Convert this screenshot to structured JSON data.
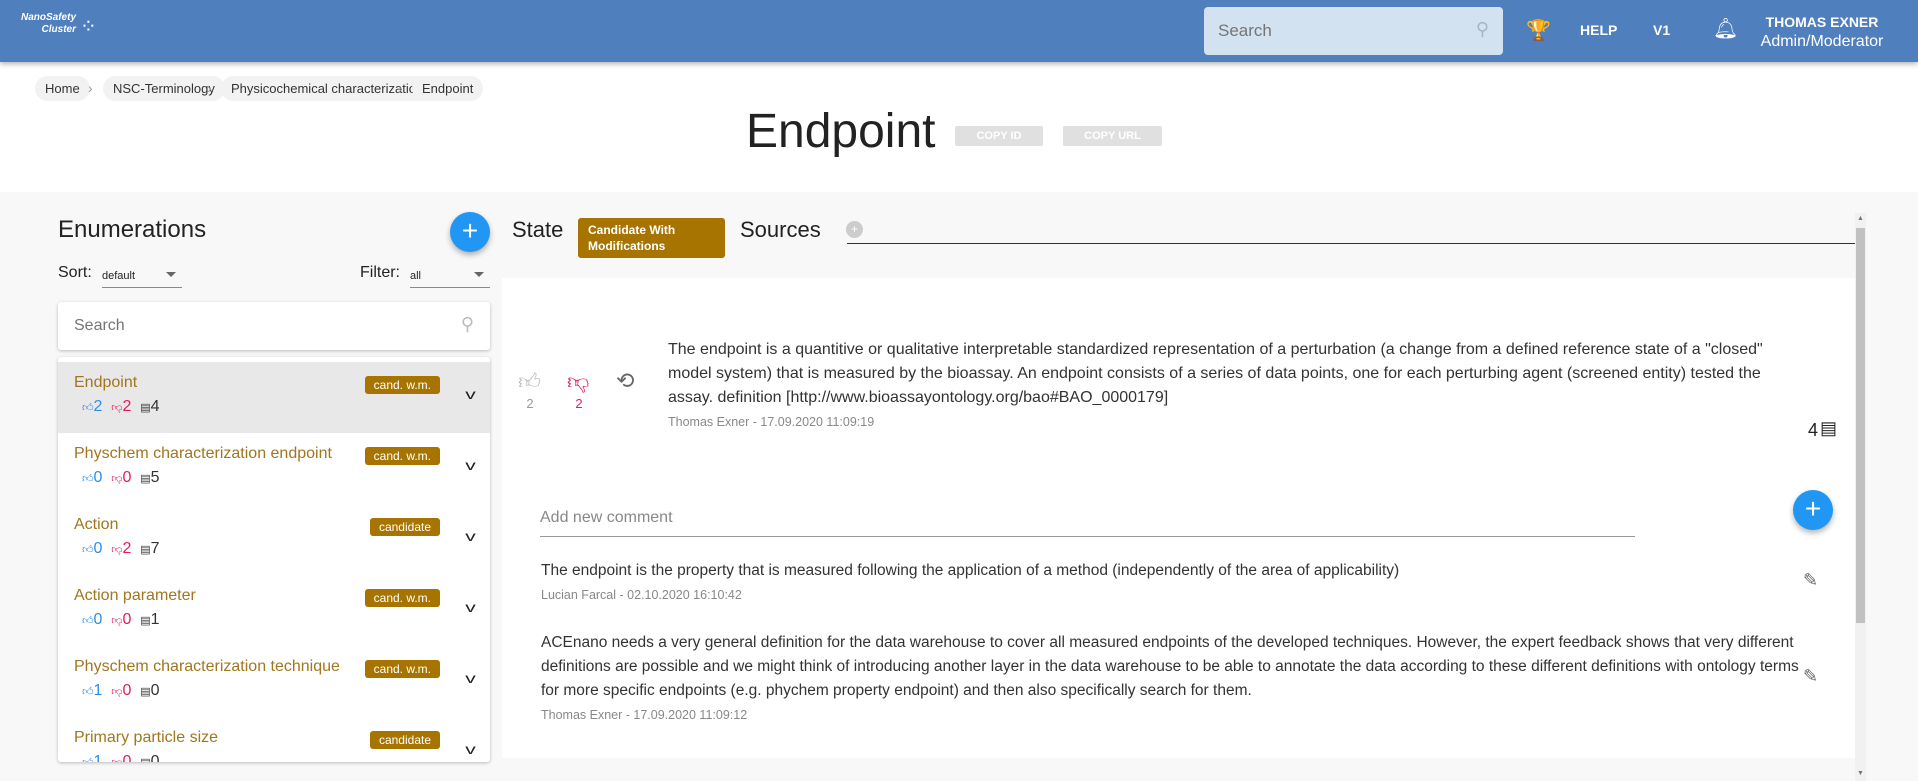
{
  "header": {
    "logo_text": "NanoSafety Cluster",
    "search_placeholder": "Search",
    "help": "HELP",
    "version": "V1",
    "user_name": "THOMAS EXNER",
    "user_role": "Admin/Moderator"
  },
  "breadcrumb": [
    "Home",
    "NSC-Terminology",
    "Physicochemical characterization",
    "Endpoint"
  ],
  "page": {
    "title": "Endpoint",
    "copy_id": "COPY ID",
    "copy_url": "COPY URL"
  },
  "sidebar": {
    "title": "Enumerations",
    "sort_label": "Sort:",
    "sort_value": "default",
    "filter_label": "Filter:",
    "filter_value": "all",
    "search_placeholder": "Search",
    "items": [
      {
        "name": "Endpoint",
        "badge": "cand. w.m.",
        "up": "2",
        "down": "2",
        "comments": "4",
        "selected": true
      },
      {
        "name": "Physchem characterization endpoint",
        "badge": "cand. w.m.",
        "up": "0",
        "down": "0",
        "comments": "5"
      },
      {
        "name": "Action",
        "badge": "candidate",
        "up": "0",
        "down": "2",
        "comments": "7"
      },
      {
        "name": "Action parameter",
        "badge": "cand. w.m.",
        "up": "0",
        "down": "0",
        "comments": "1"
      },
      {
        "name": "Physchem characterization technique",
        "badge": "cand. w.m.",
        "up": "1",
        "down": "0",
        "comments": "0"
      },
      {
        "name": "Primary particle size",
        "badge": "candidate",
        "up": "1",
        "down": "0",
        "comments": "0"
      }
    ]
  },
  "detail": {
    "state_label": "State",
    "state_value": "Candidate With Modifications",
    "sources_label": "Sources",
    "definition": {
      "text": "The endpoint is a quantitive or qualitative interpretable standardized representation of a perturbation (a change from a defined reference state of a \"closed\" model system) that is measured by the bioassay. An endpoint consists of a series of data points, one for each perturbing agent (screened entity) tested the assay. definition [http://www.bioassayontology.org/bao#BAO_0000179]",
      "meta": "Thomas Exner - 17.09.2020 11:09:19",
      "up": "2",
      "down": "2",
      "comment_count": "4"
    },
    "add_comment_placeholder": "Add new comment",
    "comments": [
      {
        "text": "The endpoint is the property that is measured following the application of a method (independently of the area of applicability)",
        "meta": "Lucian Farcal - 02.10.2020 16:10:42"
      },
      {
        "text": "ACEnano needs a very general definition for the data warehouse to cover all measured endpoints of the developed techniques. However, the expert feedback shows that very different definitions are possible and we might think of introducing another layer in the data warehouse to be able to annotate the data according to these different definitions with ontology terms for more specific endpoints (e.g. phychem property endpoint) and then also specifically search for them.",
        "meta": "Thomas Exner - 17.09.2020 11:09:12"
      }
    ]
  },
  "colors": {
    "header": "#4f7fbd",
    "accent": "#2196f3",
    "badge": "#a87400",
    "upvote": "#2f8de4",
    "downvote": "#e21c5a"
  }
}
